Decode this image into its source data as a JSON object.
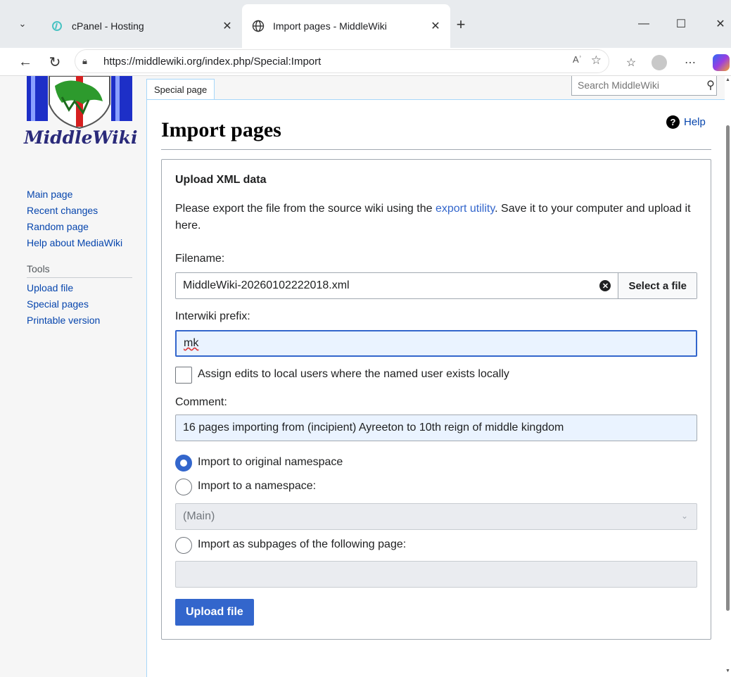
{
  "browser": {
    "tabs": [
      {
        "title": "cPanel - Hosting",
        "active": false
      },
      {
        "title": "Import pages - MiddleWiki",
        "active": true
      }
    ],
    "url": "https://middlewiki.org/index.php/Special:Import",
    "read_aloud": "Aʾ"
  },
  "wiki": {
    "logo_text": "MiddleWiki",
    "nav": [
      "Main page",
      "Recent changes",
      "Random page",
      "Help about MediaWiki"
    ],
    "tools_heading": "Tools",
    "tools": [
      "Upload file",
      "Special pages",
      "Printable version"
    ],
    "page_tab": "Special page",
    "search_placeholder": "Search MiddleWiki",
    "title": "Import pages",
    "help": "Help"
  },
  "form": {
    "legend": "Upload XML data",
    "desc_before": "Please export the file from the source wiki using the ",
    "desc_link": "export utility",
    "desc_after": ". Save it to your computer and upload it here.",
    "filename_label": "Filename:",
    "filename_value": "MiddleWiki-20260102222018.xml",
    "select_file": "Select a file",
    "interwiki_label": "Interwiki prefix:",
    "interwiki_value": "mk",
    "assign_label": "Assign edits to local users where the named user exists locally",
    "comment_label": "Comment:",
    "comment_value": "16 pages importing from (incipient) Ayreeton to 10th reign of middle kingdom",
    "radio_original": "Import to original namespace",
    "radio_namespace": "Import to a namespace:",
    "namespace_value": "(Main)",
    "radio_subpages": "Import as subpages of the following page:",
    "subpage_value": "",
    "upload": "Upload file"
  }
}
